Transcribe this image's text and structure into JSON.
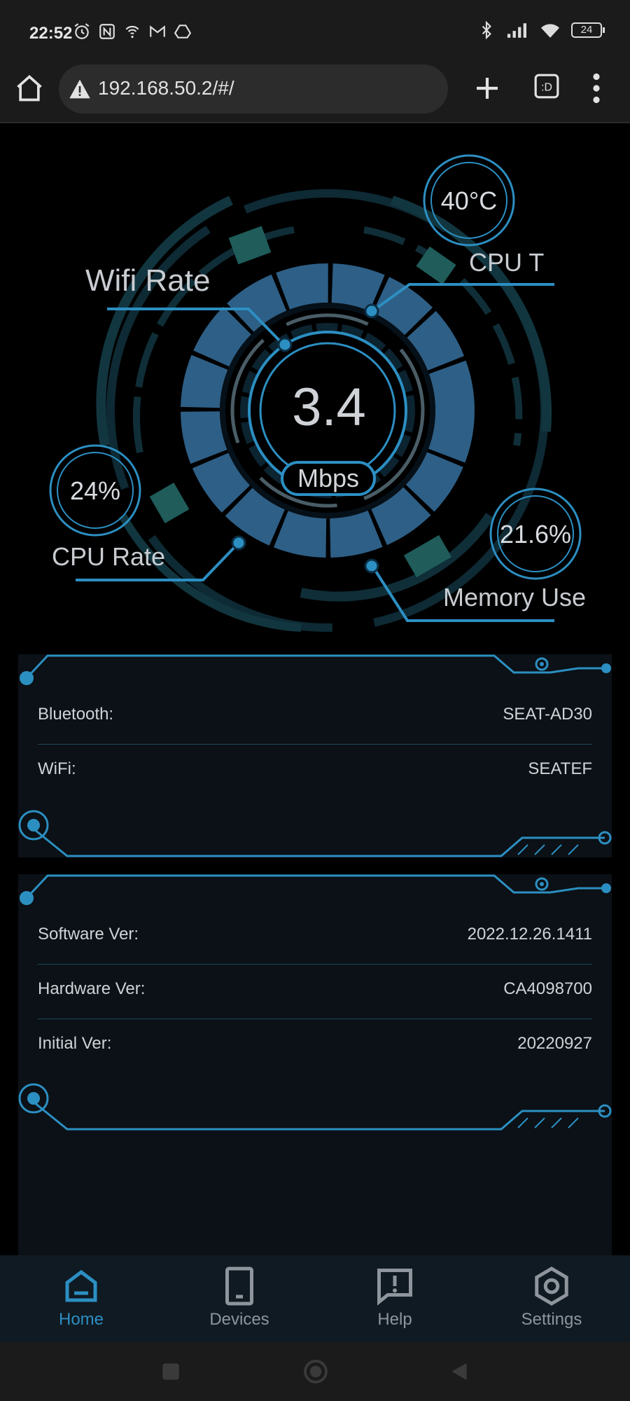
{
  "status_bar": {
    "time": "22:52",
    "battery": "24"
  },
  "browser": {
    "url": "192.168.50.2/#/"
  },
  "dashboard": {
    "center_value": "3.4",
    "center_unit": "Mbps",
    "labels": {
      "wifi_rate": "Wifi Rate",
      "cpu_temp": "CPU T",
      "cpu_rate": "CPU Rate",
      "memory_use": "Memory Use"
    },
    "gauges": {
      "cpu_temp": "40°C",
      "cpu_rate": "24%",
      "memory_use": "21.6%"
    }
  },
  "network_panel": {
    "rows": [
      {
        "key": "Bluetooth:",
        "value": "SEAT-AD30"
      },
      {
        "key": "WiFi:",
        "value": "SEATEF"
      }
    ]
  },
  "version_panel": {
    "rows": [
      {
        "key": "Software Ver:",
        "value": "2022.12.26.1411"
      },
      {
        "key": "Hardware Ver:",
        "value": "CA4098700"
      },
      {
        "key": "Initial Ver:",
        "value": "20220927"
      }
    ]
  },
  "bottom_nav": {
    "items": [
      {
        "label": "Home",
        "icon": "home-icon",
        "active": true
      },
      {
        "label": "Devices",
        "icon": "tablet-icon",
        "active": false
      },
      {
        "label": "Help",
        "icon": "help-icon",
        "active": false
      },
      {
        "label": "Settings",
        "icon": "settings-icon",
        "active": false
      }
    ]
  },
  "colors": {
    "accent": "#2c8fc2",
    "panel_bg": "#0b1116",
    "ring_blue": "#2e5f86",
    "teal": "#1f5c5a"
  }
}
